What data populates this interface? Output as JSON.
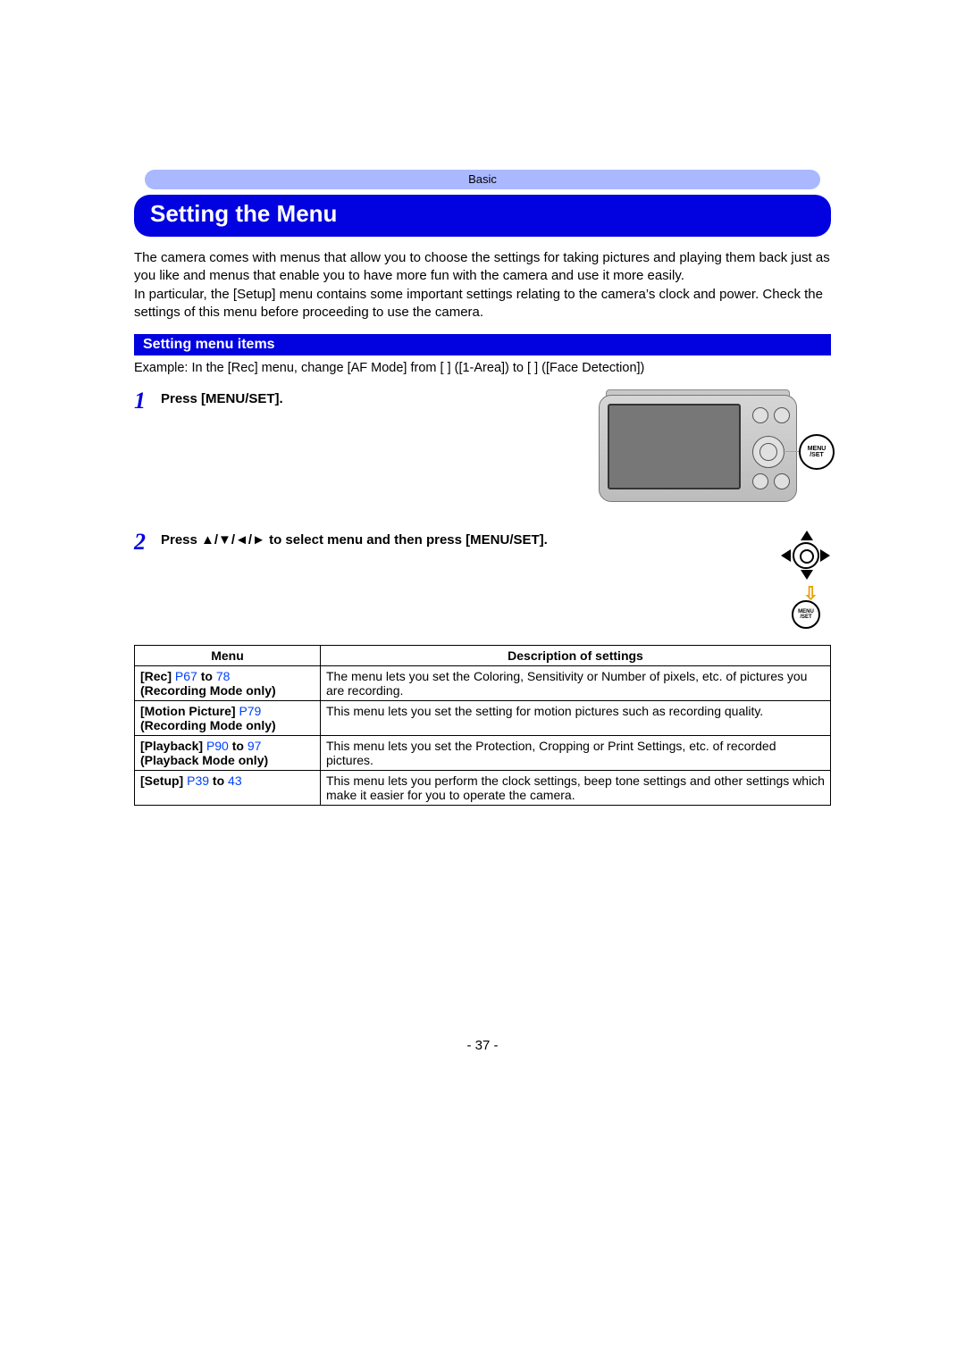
{
  "header": {
    "section": "Basic"
  },
  "title": "Setting the Menu",
  "intro": "The camera comes with menus that allow you to choose the settings for taking pictures and playing them back just as you like and menus that enable you to have more fun with the camera and use it more easily.\nIn particular, the [Setup] menu contains some important settings relating to the camera’s clock and power. Check the settings of this menu before proceeding to use the camera.",
  "subheading": "Setting menu items",
  "example": "Example: In the [Rec] menu, change [AF Mode] from [      ] ([1-Area]) to [      ] ([Face Detection])",
  "steps": {
    "s1": {
      "num": "1",
      "text": "Press [MENU/SET]."
    },
    "s2": {
      "num": "2",
      "text": "Press 3/4/2/1 to select menu and then press [MENU/SET]."
    }
  },
  "badge": {
    "line1": "MENU",
    "line2": "/SET"
  },
  "table": {
    "head_menu": "Menu",
    "head_desc": "Description of settings",
    "rows": [
      {
        "name": "[Rec]",
        "ref_a": "P67",
        "joiner": " to ",
        "ref_b": "78",
        "note": "(Recording Mode only)",
        "desc": "The menu lets you set the Coloring, Sensitivity or Number of pixels, etc. of pictures you are recording."
      },
      {
        "name": "[Motion Picture]",
        "ref_a": "P79",
        "joiner": "",
        "ref_b": "",
        "note": "(Recording Mode only)",
        "desc": "This menu lets you set the setting for motion pictures such as recording quality."
      },
      {
        "name": "[Playback]",
        "ref_a": "P90",
        "joiner": " to ",
        "ref_b": "97",
        "note": "(Playback Mode only)",
        "desc": "This menu lets you set the Protection, Cropping or Print Settings, etc. of recorded pictures."
      },
      {
        "name": "[Setup]",
        "ref_a": "P39",
        "joiner": " to ",
        "ref_b": "43",
        "note": "",
        "desc": "This menu lets you perform the clock settings, beep tone settings and other settings which make it easier for you to operate the camera."
      }
    ]
  },
  "page_number": "- 37 -"
}
